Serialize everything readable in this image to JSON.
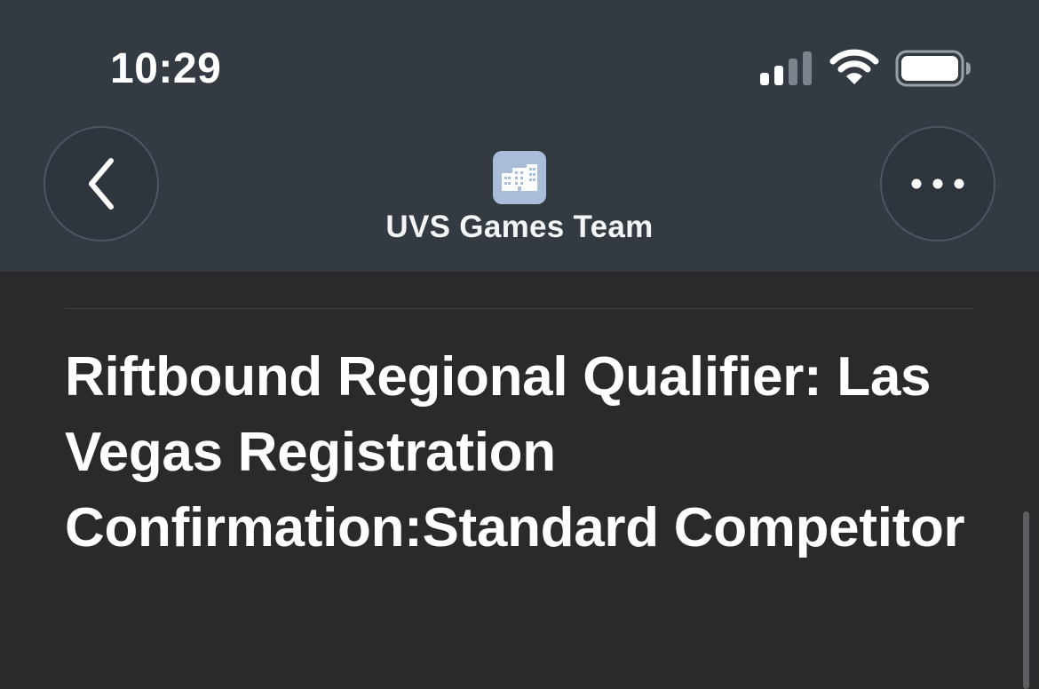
{
  "status_bar": {
    "time": "10:29",
    "icons": [
      "cellular-signal-icon",
      "wifi-icon",
      "battery-icon"
    ]
  },
  "navigation": {
    "back_icon": "chevron-left-icon",
    "more_icon": "ellipsis-icon",
    "sender_avatar_icon": "building-icon",
    "sender_name": "UVS Games Team"
  },
  "message": {
    "subject": "Riftbound Regional Qualifier: Las Vegas Registration Confirmation:Standard Competitor"
  },
  "colors": {
    "header_background": "#343a42",
    "body_background": "#2a2a2c",
    "avatar_background": "#a9bcd8",
    "text": "#ffffff"
  }
}
